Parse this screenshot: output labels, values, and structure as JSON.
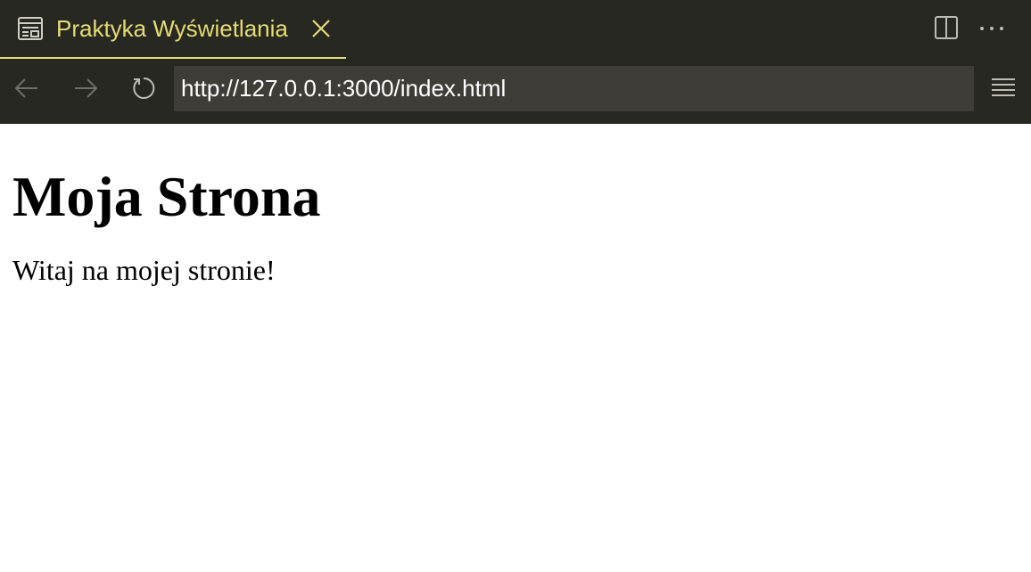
{
  "tab": {
    "title": "Praktyka Wyświetlania",
    "icon": "preview-icon",
    "close_icon": "close-icon",
    "active_color": "#e6db74"
  },
  "window_actions": {
    "split_icon": "split-editor-icon",
    "more_icon": "more-actions-icon"
  },
  "toolbar": {
    "back_icon": "arrow-left-icon",
    "forward_icon": "arrow-right-icon",
    "reload_icon": "reload-icon",
    "url": "http://127.0.0.1:3000/index.html",
    "menu_icon": "hamburger-menu-icon"
  },
  "page": {
    "heading": "Moja Strona",
    "paragraph": "Witaj na mojej stronie!"
  },
  "colors": {
    "chrome_bg": "#272822",
    "url_bg": "#3e3d38",
    "page_bg": "#ffffff"
  }
}
